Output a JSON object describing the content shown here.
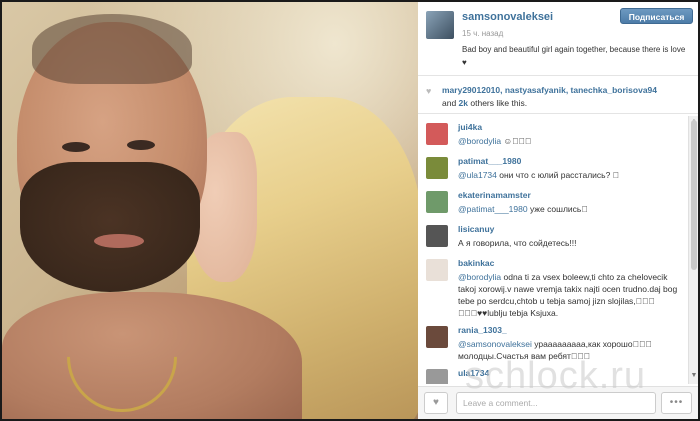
{
  "post": {
    "username": "samsonovaleksei",
    "time": "15 ч. назад",
    "caption": "Bad boy and beautiful girl again together, because there is love ♥",
    "follow_label": "Подписаться"
  },
  "likes": {
    "line1": "mary29012010, nastyasafyanik, tanechka_borisova94",
    "count": "2k",
    "line2_rest": " others like this."
  },
  "comments": [
    {
      "user": "jui4ka",
      "mention": "@borodylia",
      "text": " ☺\u0000\u0000\u0000",
      "avatar_color": "#d35a5a"
    },
    {
      "user": "patimat___1980",
      "mention": "@ula1734",
      "text": " они что с юлий расстались? \u0000",
      "avatar_color": "#7a8b3a"
    },
    {
      "user": "ekaterinamamster",
      "mention": "@patimat___1980",
      "text": " уже сошлись\u0000",
      "avatar_color": "#6f9a6a"
    },
    {
      "user": "lisicanuy",
      "mention": "",
      "text": "А я говорила, что сойдетесь!!!",
      "avatar_color": "#555555"
    },
    {
      "user": "bakinkac",
      "mention": "@borodylia",
      "text": " odna ti za vsex boleew,ti chto za chelovecik takoj xorowij.v nawe vremja takix najti ocen trudno.daj bog tebe po serdcu,chtob u tebja samoj jizn slojilas,\u0000\u0000\u0000 \u0000\u0000\u0000♥♥lublju tebja Ksjuxa.",
      "avatar_color": "#e9e0d8"
    },
    {
      "user": "rania_1303_",
      "mention": "@samsonovaleksei",
      "text": " урааааааааа,как хорошо\u0000\u0000\u0000 молодцы.Счастья вам ребят\u0000\u0000\u0000",
      "avatar_color": "#6b4a3c"
    },
    {
      "user": "ula1734",
      "mention": "",
      "text": "",
      "avatar_color": "#999999"
    }
  ],
  "footer": {
    "comment_placeholder": "Leave a comment...",
    "more_label": "•••"
  },
  "watermark": "schlock.ru",
  "colors": {
    "link": "#3f729b",
    "follow_button": "#517fa4"
  }
}
